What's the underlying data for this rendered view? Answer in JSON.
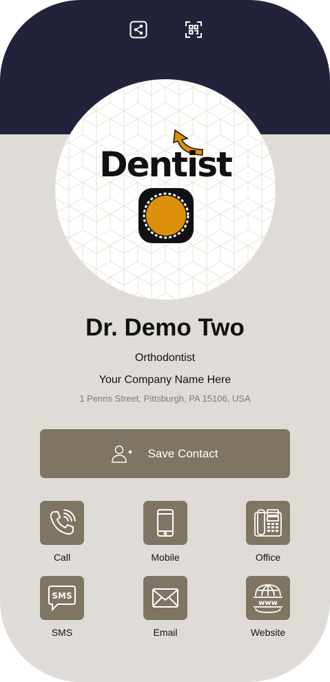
{
  "colors": {
    "header": "#22233a",
    "card_background": "#dfdcd8",
    "accent": "#7e7563",
    "logo_orange": "#dc8f0b"
  },
  "top_actions": [
    {
      "icon": "share-icon"
    },
    {
      "icon": "qr-scan-icon"
    }
  ],
  "logo": {
    "text": "Dentist"
  },
  "profile": {
    "name": "Dr. Demo Two",
    "title": "Orthodontist",
    "company": "Your Company Name Here",
    "address": "1 Penns Street, Pittsburgh, PA 15106, USA"
  },
  "save_contact": {
    "label": "Save Contact",
    "icon": "add-user-icon"
  },
  "actions": [
    {
      "label": "Call",
      "icon": "phone-icon"
    },
    {
      "label": "Mobile",
      "icon": "mobile-phone-icon"
    },
    {
      "label": "Office",
      "icon": "office-phone-icon"
    },
    {
      "label": "SMS",
      "icon": "sms-icon"
    },
    {
      "label": "Email",
      "icon": "email-icon"
    },
    {
      "label": "Website",
      "icon": "globe-icon"
    }
  ]
}
